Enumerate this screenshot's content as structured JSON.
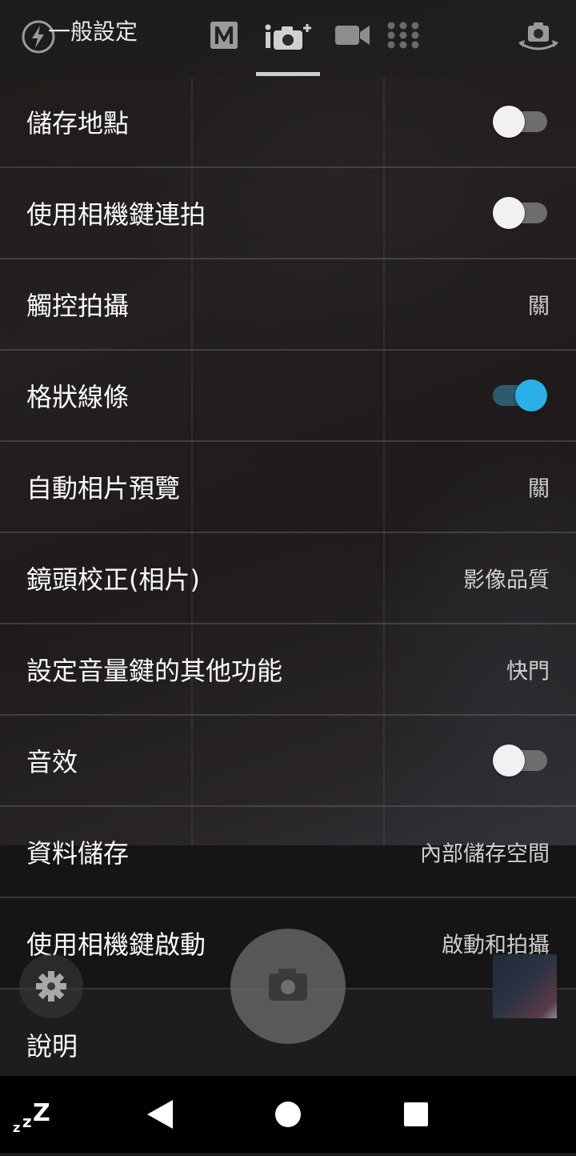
{
  "header": {
    "title": "一般設定",
    "mode_icons": [
      "manual-mode-icon",
      "superior-auto-icon",
      "video-icon",
      "apps-grid-icon"
    ],
    "right_icon": "switch-camera-icon",
    "left_icon": "flash-auto-icon"
  },
  "settings": [
    {
      "label": "儲存地點",
      "type": "toggle",
      "on": false
    },
    {
      "label": "使用相機鍵連拍",
      "type": "toggle",
      "on": false
    },
    {
      "label": "觸控拍攝",
      "type": "value",
      "value": "關"
    },
    {
      "label": "格狀線條",
      "type": "toggle",
      "on": true
    },
    {
      "label": "自動相片預覽",
      "type": "value",
      "value": "關"
    },
    {
      "label": "鏡頭校正(相片)",
      "type": "value",
      "value": "影像品質"
    },
    {
      "label": "設定音量鍵的其他功能",
      "type": "value",
      "value": "快門"
    },
    {
      "label": "音效",
      "type": "toggle",
      "on": false
    },
    {
      "label": "資料儲存",
      "type": "value",
      "value": "內部儲存空間"
    },
    {
      "label": "使用相機鍵啟動",
      "type": "value",
      "value": "啟動和拍攝"
    },
    {
      "label": "說明",
      "type": "none"
    }
  ],
  "overlay": {
    "shutter_icon": "camera-icon",
    "settings_icon": "gear-icon"
  },
  "navbar": {
    "icons": [
      "sleep-icon",
      "back-icon",
      "home-icon",
      "recents-icon"
    ],
    "sleep_glyph": "zzZ"
  },
  "colors": {
    "toggle_on_thumb": "#2ab0e6",
    "toggle_on_track": "#2f5a6c",
    "toggle_off_thumb": "#f1f1f1",
    "toggle_off_track": "#6e6e6e"
  }
}
